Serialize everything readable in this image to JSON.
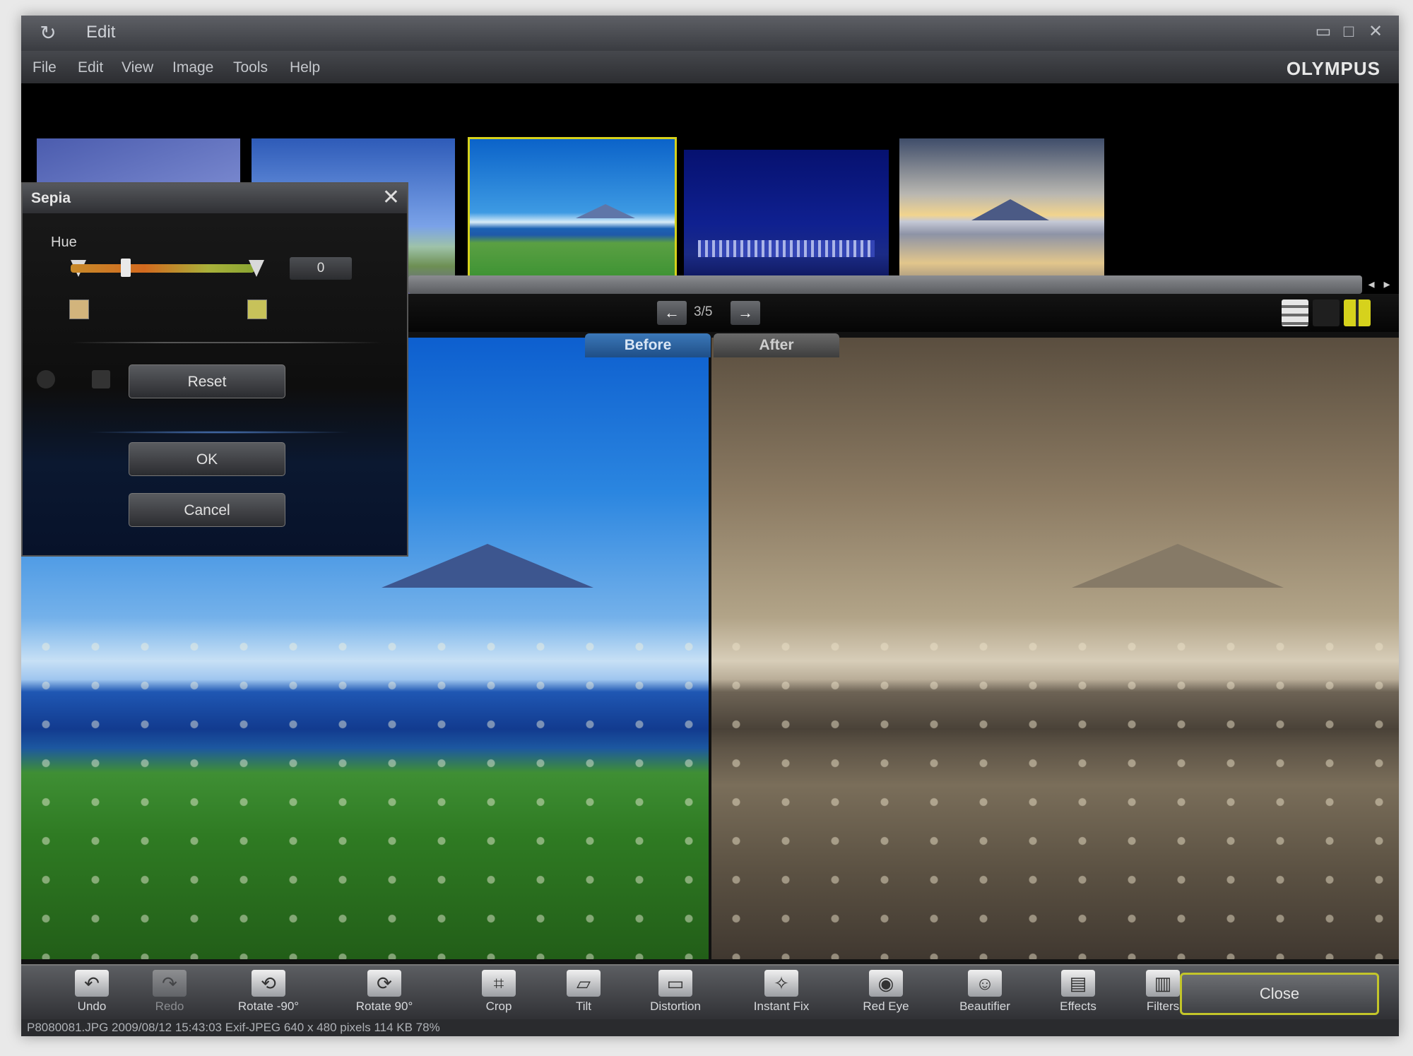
{
  "window": {
    "title": "Edit",
    "brand": "OLYMPUS"
  },
  "menu": [
    "File",
    "Edit",
    "View",
    "Image",
    "Tools",
    "Help"
  ],
  "navigation": {
    "page_count": "3/5"
  },
  "compare": {
    "before_label": "Before",
    "after_label": "After"
  },
  "dialog": {
    "title": "Sepia",
    "hue_label": "Hue",
    "hue_value": "0",
    "hue_slider_position": 0.3,
    "reset_label": "Reset",
    "ok_label": "OK",
    "cancel_label": "Cancel"
  },
  "toolbar": {
    "tools": [
      "Undo",
      "Redo",
      "Rotate -90°",
      "Rotate 90°",
      "Crop",
      "Tilt",
      "Distortion",
      "Instant Fix",
      "Red Eye",
      "Beautifier",
      "Effects",
      "Filters"
    ],
    "close_label": "Close"
  },
  "status": "P8080081.JPG   2009/08/12 15:43:03   Exif-JPEG   640 x 480 pixels   114 KB   78%"
}
